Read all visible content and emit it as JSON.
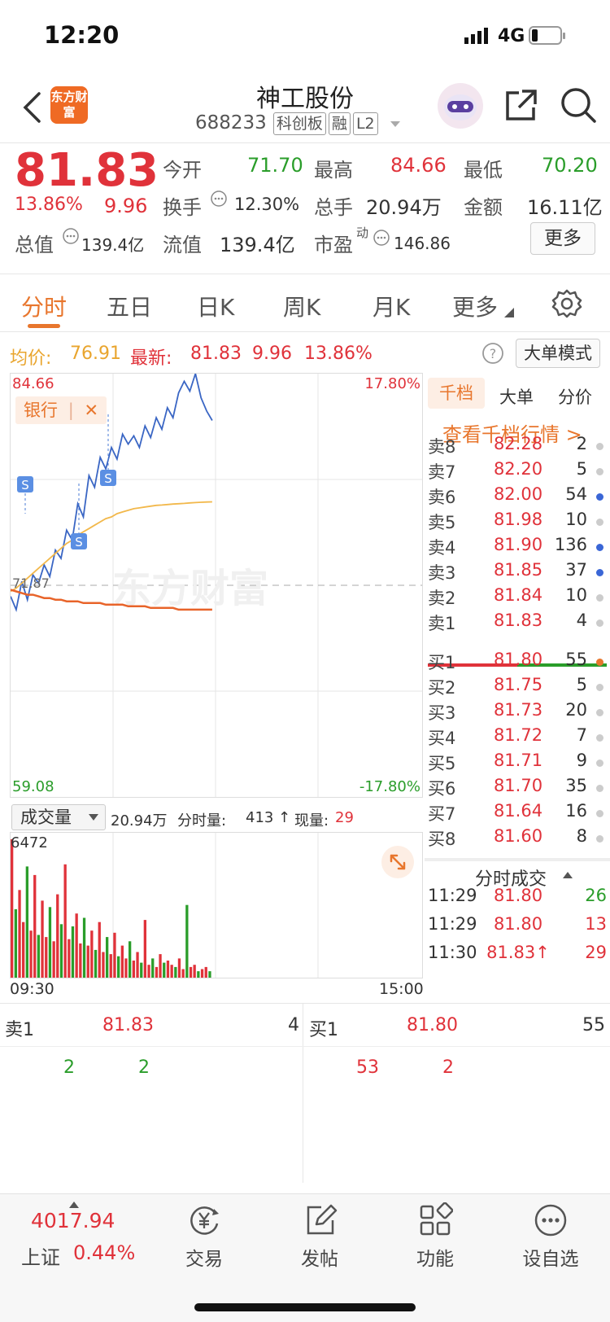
{
  "status": {
    "time": "12:20",
    "network": "4G"
  },
  "header": {
    "title": "神工股份",
    "code": "688233",
    "tags": [
      "科创板",
      "融",
      "L2"
    ],
    "logo_text": "东方财富"
  },
  "quote": {
    "price": "81.83",
    "change_pct": "13.86%",
    "change": "9.96",
    "open_label": "今开",
    "open": "71.70",
    "high_label": "最高",
    "high": "84.66",
    "low_label": "最低",
    "low": "70.20",
    "turnover_label": "换手",
    "turnover": "12.30%",
    "volume_label": "总手",
    "volume": "20.94万",
    "amount_label": "金额",
    "amount": "16.11亿",
    "mktcap_label": "总值",
    "mktcap": "139.4亿",
    "float_label": "流值",
    "float": "139.4亿",
    "pe_label": "市盈",
    "pe_sup": "动",
    "pe": "146.86",
    "more": "更多"
  },
  "tabs": [
    "分时",
    "五日",
    "日K",
    "周K",
    "月K",
    "更多"
  ],
  "info": {
    "avg_label": "均价:",
    "avg": "76.91",
    "last_label": "最新:",
    "last": "81.83",
    "change": "9.96",
    "pct": "13.86%",
    "mode": "大单模式"
  },
  "chart": {
    "top_price": "84.66",
    "bottom_price": "59.08",
    "top_pct": "17.80%",
    "bottom_pct": "-17.80%",
    "ref_price": "71.87",
    "tag": "银行",
    "signal": "S",
    "watermark": "东方财富",
    "start_time": "09:30",
    "end_time": "15:00",
    "vol_max": "6472"
  },
  "chart_data": {
    "type": "line",
    "xlabel": "",
    "ylabel": "",
    "ylim": [
      59.08,
      84.66
    ],
    "series": [
      {
        "name": "最新",
        "values": [
          71.2,
          70.4,
          72.1,
          71.0,
          72.5,
          72.0,
          73.1,
          72.4,
          74.0,
          73.5,
          75.2,
          74.6,
          76.8,
          76.0,
          78.5,
          77.8,
          79.6,
          78.9,
          80.2,
          79.5,
          81.0,
          80.4,
          80.9,
          80.2,
          81.5,
          80.8,
          82.0,
          81.3,
          82.6,
          82.0,
          83.5,
          84.2,
          83.6,
          84.66,
          83.2,
          82.4,
          81.83
        ]
      },
      {
        "name": "均价",
        "values": [
          71.5,
          71.7,
          72.0,
          72.3,
          72.6,
          72.9,
          73.2,
          73.5,
          73.8,
          74.1,
          74.4,
          74.6,
          74.9,
          75.1,
          75.3,
          75.5,
          75.7,
          75.9,
          76.0,
          76.2,
          76.3,
          76.4,
          76.5,
          76.55,
          76.6,
          76.65,
          76.7,
          76.72,
          76.75,
          76.78,
          76.8,
          76.82,
          76.85,
          76.87,
          76.89,
          76.9,
          76.91
        ]
      },
      {
        "name": "银行",
        "values": [
          71.6,
          71.5,
          71.4,
          71.3,
          71.3,
          71.2,
          71.1,
          71.1,
          71.0,
          71.0,
          70.9,
          70.9,
          70.9,
          70.8,
          70.8,
          70.8,
          70.8,
          70.7,
          70.7,
          70.7,
          70.7,
          70.6,
          70.6,
          70.6,
          70.6,
          70.5,
          70.5,
          70.5,
          70.5,
          70.5,
          70.4,
          70.4,
          70.4,
          70.4,
          70.4,
          70.4,
          70.4
        ]
      }
    ],
    "volume": [
      6472,
      3200,
      4100,
      2600,
      5200,
      2200,
      4800,
      2000,
      3600,
      1900,
      3300,
      1700,
      3900,
      2500,
      5300,
      1800,
      2400,
      3000,
      1600,
      2800,
      1500,
      2200,
      1300,
      2600,
      1200,
      1900,
      1100,
      2100,
      1000,
      1500,
      900,
      1700,
      800,
      1200,
      700,
      2700,
      600,
      900,
      500,
      1100,
      700,
      800,
      600,
      500,
      900,
      400,
      3400,
      500,
      600,
      300,
      400,
      500,
      300
    ]
  },
  "volume_bar": {
    "label": "成交量",
    "total": "20.94万",
    "seg_label": "分时量:",
    "seg": "413",
    "now_label": "现量:",
    "now": "29"
  },
  "side": {
    "tabs": [
      "千档",
      "大单",
      "分价"
    ],
    "link": "查看千档行情 >"
  },
  "orderbook": {
    "asks": [
      {
        "name": "卖8",
        "price": "82.28",
        "qty": "2",
        "dot": "#ccc"
      },
      {
        "name": "卖7",
        "price": "82.20",
        "qty": "5",
        "dot": "#ccc"
      },
      {
        "name": "卖6",
        "price": "82.00",
        "qty": "54",
        "dot": "#3a66d6"
      },
      {
        "name": "卖5",
        "price": "81.98",
        "qty": "10",
        "dot": "#ccc"
      },
      {
        "name": "卖4",
        "price": "81.90",
        "qty": "136",
        "dot": "#3a66d6"
      },
      {
        "name": "卖3",
        "price": "81.85",
        "qty": "37",
        "dot": "#3a66d6"
      },
      {
        "name": "卖2",
        "price": "81.84",
        "qty": "10",
        "dot": "#ccc"
      },
      {
        "name": "卖1",
        "price": "81.83",
        "qty": "4",
        "dot": "#ccc"
      }
    ],
    "bids": [
      {
        "name": "买1",
        "price": "81.80",
        "qty": "55",
        "dot": "#e8762d"
      },
      {
        "name": "买2",
        "price": "81.75",
        "qty": "5",
        "dot": "#ccc"
      },
      {
        "name": "买3",
        "price": "81.73",
        "qty": "20",
        "dot": "#ccc"
      },
      {
        "name": "买4",
        "price": "81.72",
        "qty": "7",
        "dot": "#ccc"
      },
      {
        "name": "买5",
        "price": "81.71",
        "qty": "9",
        "dot": "#ccc"
      },
      {
        "name": "买6",
        "price": "81.70",
        "qty": "35",
        "dot": "#ccc"
      },
      {
        "name": "买7",
        "price": "81.64",
        "qty": "16",
        "dot": "#ccc"
      },
      {
        "name": "买8",
        "price": "81.60",
        "qty": "8",
        "dot": "#ccc"
      }
    ]
  },
  "trades": {
    "title": "分时成交",
    "rows": [
      {
        "time": "11:29",
        "price": "81.80",
        "qty": "26",
        "color": "green"
      },
      {
        "time": "11:29",
        "price": "81.80",
        "qty": "13",
        "color": "red"
      },
      {
        "time": "11:30",
        "price": "81.83↑",
        "qty": "29",
        "color": "red"
      }
    ]
  },
  "level1": {
    "sell_label": "卖1",
    "sell_price": "81.83",
    "sell_qty": "4",
    "sell_detail": [
      "2",
      "2"
    ],
    "buy_label": "买1",
    "buy_price": "81.80",
    "buy_qty": "55",
    "buy_detail": [
      "53",
      "2"
    ]
  },
  "nav": {
    "index_value": "4017.94",
    "index_name": "上证",
    "index_pct": "0.44%",
    "items": [
      "交易",
      "发帖",
      "功能",
      "设自选"
    ]
  }
}
